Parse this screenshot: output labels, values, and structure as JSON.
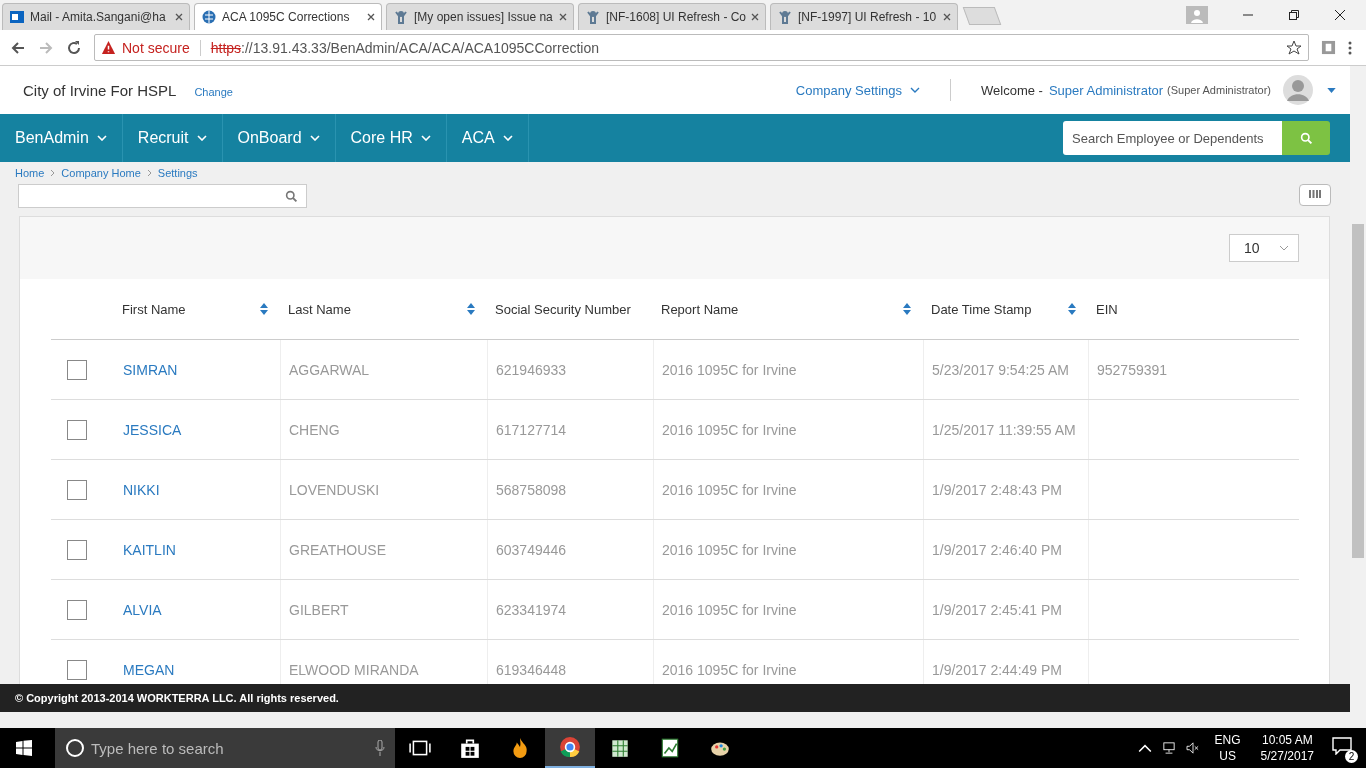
{
  "browser": {
    "tabs": [
      {
        "title": "Mail - Amita.Sangani@ha",
        "kind": "mail",
        "selected": false
      },
      {
        "title": "ACA 1095C Corrections",
        "kind": "page",
        "selected": true
      },
      {
        "title": "[My open issues] Issue na",
        "kind": "tracker",
        "selected": false
      },
      {
        "title": "[NF-1608] UI Refresh - Co",
        "kind": "tracker",
        "selected": false
      },
      {
        "title": "[NF-1997] UI Refresh - 10",
        "kind": "tracker",
        "selected": false
      }
    ],
    "security": "Not secure",
    "scheme": "https",
    "address": "://13.91.43.33/BenAdmin/ACA/ACA/ACA1095CCorrection"
  },
  "header": {
    "company": "City of Irvine For HSPL",
    "change": "Change",
    "company_settings": "Company Settings",
    "welcome": "Welcome -",
    "user_name": "Super Administrator",
    "user_role": "(Super Administrator)"
  },
  "nav": {
    "items": [
      "BenAdmin",
      "Recruit",
      "OnBoard",
      "Core HR",
      "ACA"
    ],
    "search_placeholder": "Search Employee or Dependents"
  },
  "breadcrumb": [
    "Home",
    "Company Home",
    "Settings"
  ],
  "table": {
    "page_size": "10",
    "columns": [
      {
        "label": "First Name",
        "sortable": true
      },
      {
        "label": "Last Name",
        "sortable": true
      },
      {
        "label": "Social Security Number",
        "sortable": false
      },
      {
        "label": "Report Name",
        "sortable": true
      },
      {
        "label": "Date Time Stamp",
        "sortable": true
      },
      {
        "label": "EIN",
        "sortable": false
      }
    ],
    "rows": [
      {
        "checked": false,
        "cells": [
          "SIMRAN",
          "AGGARWAL",
          "621946933",
          "2016 1095C for Irvine",
          "5/23/2017 9:54:25 AM",
          "952759391"
        ]
      },
      {
        "checked": false,
        "cells": [
          "JESSICA",
          "CHENG",
          "617127714",
          "2016 1095C for Irvine",
          "1/25/2017 11:39:55 AM",
          ""
        ]
      },
      {
        "checked": false,
        "cells": [
          "NIKKI",
          "LOVENDUSKI",
          "568758098",
          "2016 1095C for Irvine",
          "1/9/2017 2:48:43 PM",
          ""
        ]
      },
      {
        "checked": false,
        "cells": [
          "KAITLIN",
          "GREATHOUSE",
          "603749446",
          "2016 1095C for Irvine",
          "1/9/2017 2:46:40 PM",
          ""
        ]
      },
      {
        "checked": false,
        "cells": [
          "ALVIA",
          "GILBERT",
          "623341974",
          "2016 1095C for Irvine",
          "1/9/2017 2:45:41 PM",
          ""
        ]
      },
      {
        "checked": false,
        "cells": [
          "MEGAN",
          "ELWOOD MIRANDA",
          "619346448",
          "2016 1095C for Irvine",
          "1/9/2017 2:44:49 PM",
          ""
        ]
      }
    ]
  },
  "footer": {
    "copyright": "© Copyright 2013-2014 WORKTERRA LLC. All rights reserved."
  },
  "taskbar": {
    "search_placeholder": "Type here to search",
    "language": "ENG",
    "region": "US",
    "time": "10:05 AM",
    "date": "5/27/2017",
    "notifications": "2"
  }
}
